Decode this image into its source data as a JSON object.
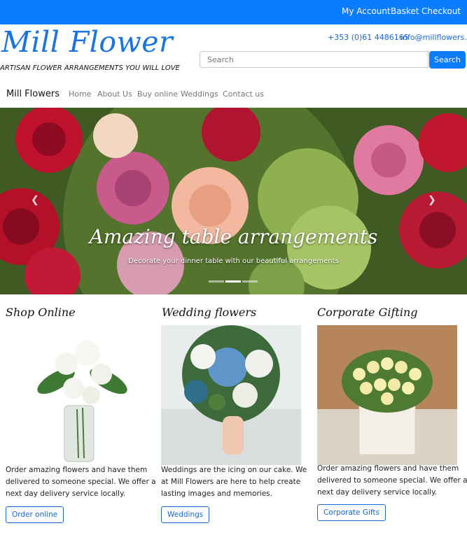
{
  "topbar": {
    "links": [
      "My Account",
      "Basket",
      "Checkout"
    ]
  },
  "header": {
    "logo": "Mill Flower",
    "tagline": "ARTISAN FLOWER ARRANGEMENTS YOU WILL LOVE",
    "phone": "+353 (0)61 4486165",
    "email": "info@millflowers.ie",
    "search": {
      "placeholder": "Search",
      "button": "Search"
    }
  },
  "nav": {
    "brand": "Mill Flowers",
    "items": [
      "Home",
      "About Us",
      "Buy online",
      "Weddings",
      "Contact us"
    ]
  },
  "hero": {
    "title": "Amazing table arrangements",
    "subtitle": "Decorate your dinner table with our beautiful arrangements",
    "prev_icon": "chevron-left-icon",
    "next_icon": "chevron-right-icon",
    "slides": 3,
    "active_slide": 2
  },
  "cards": [
    {
      "title": "Shop Online",
      "text": "Order amazing flowers and have them delivered to someone special. We offer a next day delivery service locally.",
      "button": "Order online"
    },
    {
      "title": "Wedding flowers",
      "text": "Weddings are the icing on our cake. We at Mill Flowers are here to help create lasting images and memories.",
      "button": "Weddings"
    },
    {
      "title": "Corporate Gifting",
      "text": "Order amazing flowers and have them delivered to someone special. We offer a next day delivery service locally.",
      "button": "Corporate Gifts"
    }
  ],
  "colors": {
    "brand_blue": "#0a7cff",
    "link_blue": "#1a66d6",
    "logo_blue": "#1a74df"
  }
}
